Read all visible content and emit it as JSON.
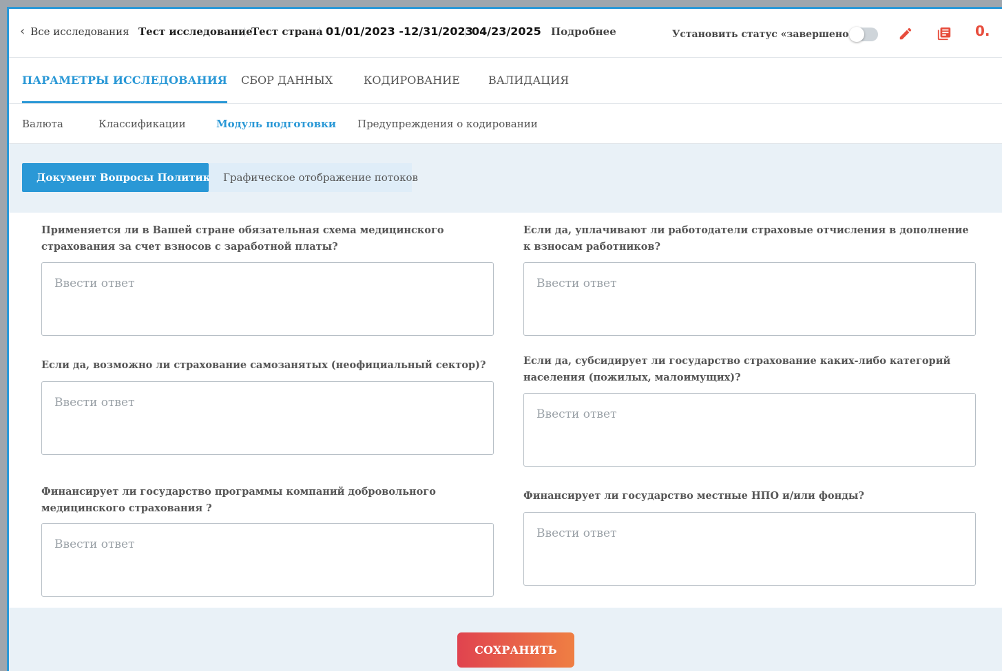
{
  "header": {
    "back_label": "Все исследования",
    "study_name": "Тест исследование",
    "country": "Тест страна",
    "date_range": "01/01/2023 -12/31/2023",
    "date": "04/23/2025",
    "details_link": "Подробнее",
    "status_label": "Установить статус «завершено»",
    "status_toggle_on": false,
    "counter": "0.",
    "accent_color": "#2a98d6",
    "danger_color": "#e74c3c"
  },
  "tabs": [
    {
      "label": "ПАРАМЕТРЫ ИССЛЕДОВАНИЯ",
      "active": true
    },
    {
      "label": "СБОР ДАННЫХ",
      "active": false
    },
    {
      "label": "КОДИРОВАНИЕ",
      "active": false
    },
    {
      "label": "ВАЛИДАЦИЯ",
      "active": false
    }
  ],
  "subtabs": [
    {
      "label": "Валюта",
      "active": false
    },
    {
      "label": "Классификации",
      "active": false
    },
    {
      "label": "Модуль подготовки",
      "active": true
    },
    {
      "label": "Предупреждения о кодировании",
      "active": false
    }
  ],
  "view_toggle": {
    "active_label": "Документ Вопросы Политики",
    "inactive_label": "Графическое отображение потоков"
  },
  "form": {
    "placeholder": "Ввести ответ",
    "questions": [
      {
        "text": "Применяется ли в Вашей стране обязательная схема медицинского страхования за счет взносов с заработной платы?",
        "value": ""
      },
      {
        "text": "Если да, уплачивают ли работодатели страховые отчисления в дополнение к взносам работников?",
        "value": ""
      },
      {
        "text": "Если да, возможно ли страхование самозанятых (неофициальный сектор)?",
        "value": ""
      },
      {
        "text": "Если да, субсидирует ли государство страхование каких-либо категорий населения (пожилых, малоимущих)?",
        "value": ""
      },
      {
        "text": "Финансирует ли государство программы компаний добровольного медицинского страхования ?",
        "value": ""
      },
      {
        "text": "Финансирует ли государство местные НПО и/или фонды?",
        "value": ""
      }
    ]
  },
  "save_label": "СОХРАНИТЬ",
  "icons": {
    "edit": "pencil-icon",
    "document": "document-list-icon"
  }
}
